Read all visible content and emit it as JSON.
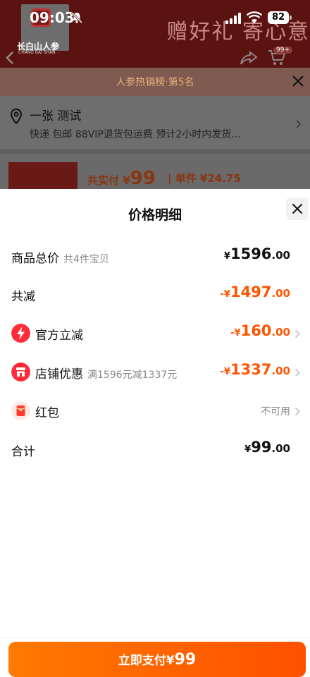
{
  "status_bar": {
    "time": "09:03",
    "battery": "82"
  },
  "header": {
    "banner_text": "赠好礼 寄心意",
    "brand_name": "长白山人参",
    "brand_sub": "CHANG BAI SHAN",
    "cart_badge": "99+"
  },
  "rank_bar": {
    "text": "人参热销榜·第5名"
  },
  "address": {
    "name": "一张 测试",
    "detail": "快递 包邮 88VIP退货包运费 预计2小时内发货..."
  },
  "product": {
    "total_label": "共实付 ¥",
    "total_value": "99",
    "unit_text": "| 单件 ¥24.75"
  },
  "sheet": {
    "title": "价格明细",
    "rows": [
      {
        "label": "商品总价",
        "sub": "共4件宝贝",
        "currency": "¥",
        "int": "1596",
        "dec": ".00"
      },
      {
        "label": "共减",
        "currency": "-¥",
        "int": "1497",
        "dec": ".00"
      },
      {
        "label": "官方立减",
        "currency": "-¥",
        "int": "160",
        "dec": ".00",
        "icon": "lightning-icon"
      },
      {
        "label": "店铺优惠",
        "sub": "满1596元减1337元",
        "currency": "-¥",
        "int": "1337",
        "dec": ".00",
        "icon": "shop-icon"
      },
      {
        "label": "红包",
        "value_text": "不可用",
        "icon": "red-envelope-icon"
      },
      {
        "label": "合计",
        "currency": "¥",
        "int": "99",
        "dec": ".00"
      }
    ]
  },
  "footer": {
    "pay_label": "立即支付",
    "pay_currency": "¥",
    "pay_amount": "99"
  },
  "colors": {
    "accent": "#ff5500",
    "pay_gradient_start": "#ff7a00",
    "pay_gradient_end": "#ff5000",
    "icon_red": "#ff2a3a"
  }
}
